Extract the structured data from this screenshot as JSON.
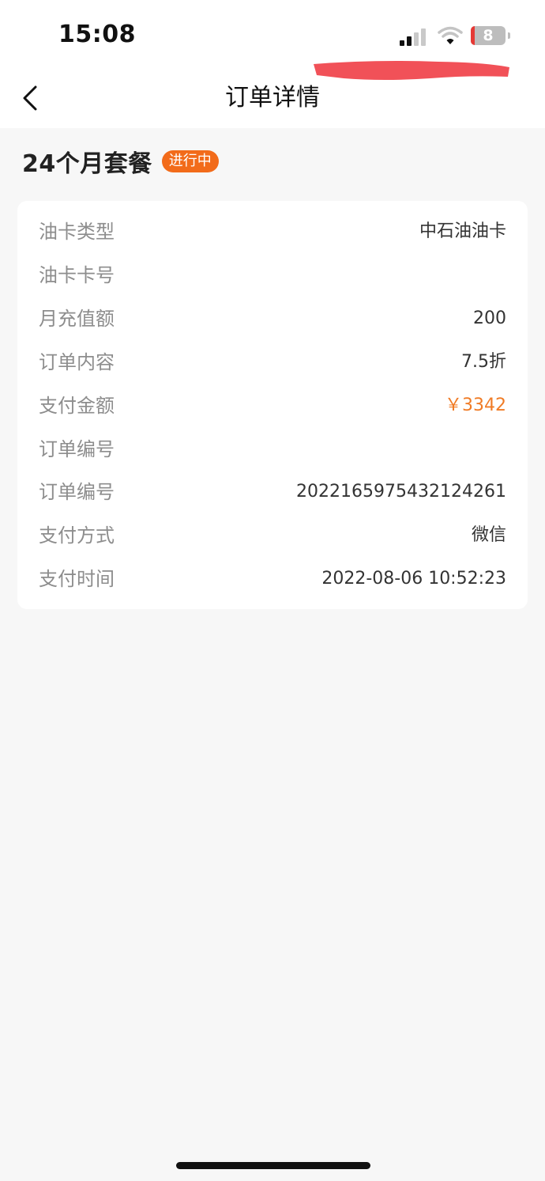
{
  "status_bar": {
    "time": "15:08",
    "battery_level": "8"
  },
  "header": {
    "title": "订单详情"
  },
  "plan": {
    "title": "24个月套餐",
    "status_badge": "进行中"
  },
  "details": [
    {
      "label": "油卡类型",
      "value": "中石油油卡"
    },
    {
      "label": "油卡卡号",
      "value": ""
    },
    {
      "label": "月充值额",
      "value": "200"
    },
    {
      "label": "订单内容",
      "value": "7.5折"
    },
    {
      "label": "支付金额",
      "value": "￥3342"
    },
    {
      "label": "订单编号",
      "value": ""
    },
    {
      "label": "订单编号",
      "value": "2022165975432124261"
    },
    {
      "label": "支付方式",
      "value": "微信"
    },
    {
      "label": "支付时间",
      "value": "2022-08-06 10:52:23"
    }
  ],
  "colors": {
    "accent": "#f26b1a",
    "price": "#f07b25",
    "redaction": "#f0484f",
    "label": "#8d8d8d"
  },
  "icons": {
    "back": "chevron-left-icon",
    "signal": "cellular-signal-icon",
    "wifi": "wifi-icon",
    "battery": "battery-icon"
  }
}
